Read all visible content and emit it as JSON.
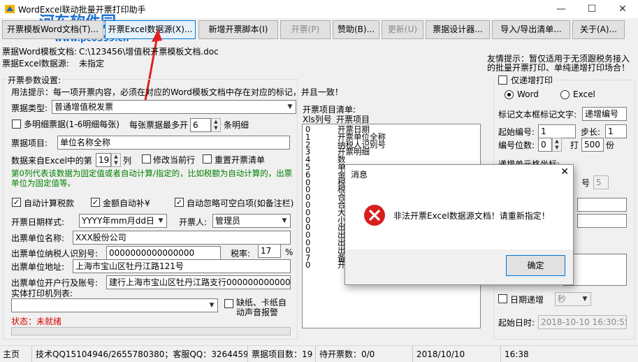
{
  "window": {
    "title": "WordExcel联动批量开票打印助手",
    "minimize": "—",
    "maximize": "☐",
    "close": "✕"
  },
  "watermark": {
    "name": "河东软件园",
    "url": "www.pc0359.cn"
  },
  "toolbar": {
    "open_word": "开票模板Word文档(T)...",
    "open_excel": "开票Excel数据源(X)...",
    "new_script": "新增开票脚本(I)",
    "start_invoice": "开票(P)",
    "help": "赞助(B)...",
    "update": "更新(U)",
    "designer": "票据设计器...",
    "import_export": "导入/导出清单...",
    "about": "关于(A)..."
  },
  "info": {
    "word_label": "票据Word模板文档:",
    "word_path": "C:\\123456\\增值税开票模板文档.doc",
    "excel_label": "票据Excel数据源:",
    "excel_value": "未指定",
    "tip_line1": "友情提示：暂仅适用于无须跟税务接入",
    "tip_line2": "的批量开票打印、单纯递增打印场合！"
  },
  "params": {
    "group_title": "开票参数设置:",
    "usage": "用法提示：每一项开票内容，必须在对应的Word模板文档中存在对应的标记，并且一致！",
    "invoice_type_label": "票据类型:",
    "invoice_type_value": "普通增值税发票",
    "multi_detail_label": "多明细票据(1-6明细每张)",
    "max_per_invoice_label": "每张票据最多开",
    "max_per_invoice_value": "6",
    "detail_suffix": "条明细",
    "project_label": "票据项目:",
    "project_value": "单位名称全称",
    "data_from_label": "数据来自Excel中的第",
    "data_from_value": "19",
    "column_suffix": "列",
    "modify_current_label": "修改当前行",
    "reset_list_label": "重置开票清单",
    "note": "第0列代表该数据为固定值或者自动计算/指定的，比如税额为自动计算的，出票单位为固定值等。",
    "auto_tax_label": "自动计算税款",
    "auto_total_label": "金额自动补¥",
    "ignore_blank_label": "自动忽略可空白项(如备注栏)",
    "date_format_label": "开票日期样式:",
    "date_format_value": "YYYY年mm月dd日",
    "drawer_label": "开票人:",
    "drawer_value": "管理员",
    "issuer_name_label": "出票单位名称:",
    "issuer_name_value": "XXX股份公司",
    "taxpayer_id_label": "出票单位纳税人识别号:",
    "taxpayer_id_value": "0000000000000000",
    "tax_rate_label": "税率:",
    "tax_rate_value": "17",
    "tax_rate_unit": "%",
    "address_label": "出票单位地址:",
    "address_value": "上海市宝山区牡丹江路121号",
    "bank_label": "出票单位开户行及账号:",
    "bank_value": "建行上海市宝山区牡丹江路支行000000000000000",
    "printer_label": "实体打印机列表:",
    "printer_value": "",
    "paper_alarm_line1": "缺纸、卡纸自",
    "paper_alarm_line2": "动声音报警",
    "status_label": "状态：未就绪",
    "status_color": "#d40000"
  },
  "item_list": {
    "title": "开票项目清单:",
    "col_xls": "Xls列号",
    "col_item": "开票项目",
    "rows": [
      {
        "col": "0",
        "item": "开票日期"
      },
      {
        "col": "1",
        "item": "开票单位全称"
      },
      {
        "col": "2",
        "item": "纳税人识别号"
      },
      {
        "col": "3",
        "item": "开票明细"
      },
      {
        "col": "4",
        "item": "数"
      },
      {
        "col": "5",
        "item": "单"
      },
      {
        "col": "6",
        "item": "金"
      },
      {
        "col": "0",
        "item": "税"
      },
      {
        "col": "0",
        "item": "税"
      },
      {
        "col": "0",
        "item": "合"
      },
      {
        "col": "0",
        "item": "合"
      },
      {
        "col": "0",
        "item": "大"
      },
      {
        "col": "0",
        "item": "小"
      },
      {
        "col": "0",
        "item": "出"
      },
      {
        "col": "0",
        "item": "出"
      },
      {
        "col": "0",
        "item": "出"
      },
      {
        "col": "0",
        "item": "出"
      },
      {
        "col": "7",
        "item": "备注"
      },
      {
        "col": "0",
        "item": "开票人"
      }
    ]
  },
  "increment": {
    "group_title": "仅递增打印",
    "radio_word": "Word",
    "radio_excel": "Excel",
    "marker_label": "标记文本框标记文字:",
    "marker_value": "递增编号",
    "start_label": "起始编号:",
    "start_value": "1",
    "step_label": "步长:",
    "step_value": "1",
    "digits_label": "编号位数:",
    "digits_value": "0",
    "copies_label": "打",
    "copies_value": "500",
    "copies_suffix": "份",
    "cell_label": "递增单元格坐标:",
    "partial_label": "号",
    "partial_value": "5",
    "date_increment_label": "日期递增",
    "date_unit_value": "秒",
    "start_time_label": "起始日时:",
    "start_time_value": "2018-10-10 16:30:55"
  },
  "dialog": {
    "title": "消息",
    "close": "✕",
    "message": "非法开票Excel数据源文档！请重新指定！",
    "ok": "确定",
    "error_color": "#d81e1e"
  },
  "statusbar": {
    "page": "主页",
    "support": "技术QQ15104946/2655780380；客服QQ：3264459122",
    "item_count_label": "票据项目数：19",
    "pending_label": "待开票数：0/0",
    "date": "2018/10/10",
    "time": "16:38"
  },
  "colors": {
    "arrow": "#e02020",
    "note_green": "#008000"
  }
}
